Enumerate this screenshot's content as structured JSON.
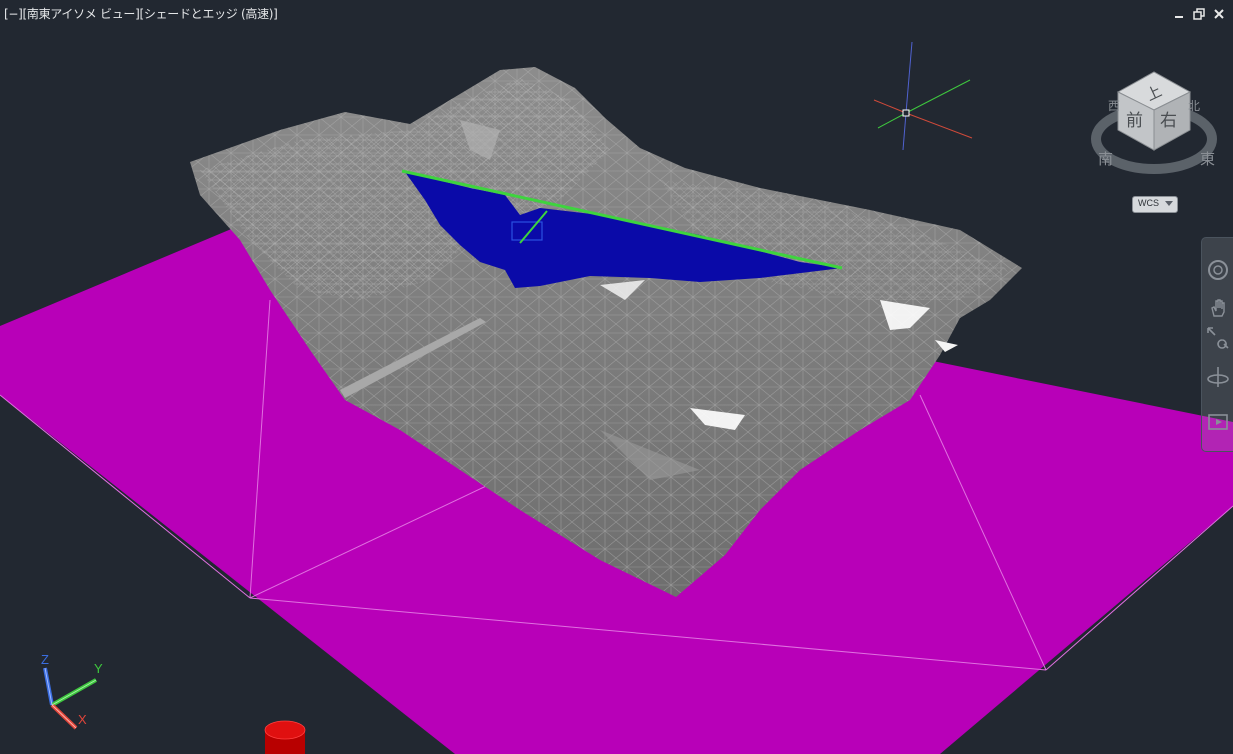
{
  "viewport": {
    "label": "[−][南東アイソメ ビュー][シェードとエッジ (高速)]"
  },
  "window_controls": {
    "minimize_icon": "minimize-icon",
    "restore_icon": "restore-icon",
    "close_icon": "close-icon"
  },
  "viewcube": {
    "top": "上",
    "front": "前",
    "right": "右",
    "compass_west": "西",
    "compass_north": "北",
    "compass_south": "南",
    "compass_east": "東"
  },
  "wcs": {
    "label": "WCS"
  },
  "ucs": {
    "x": "X",
    "y": "Y",
    "z": "Z"
  },
  "navbar": {
    "items": [
      "steering-wheel-icon",
      "pan-icon",
      "zoom-extents-icon",
      "orbit-icon",
      "showmotion-icon"
    ]
  },
  "colors": {
    "background": "#222831",
    "ground_plane": "#b800b8",
    "terrain": "#808080",
    "water": "#0a0aa8",
    "section_line": "#3ed43e",
    "axis_x": "#e0453a",
    "axis_y": "#3ec83e",
    "axis_z": "#3a6de0"
  }
}
